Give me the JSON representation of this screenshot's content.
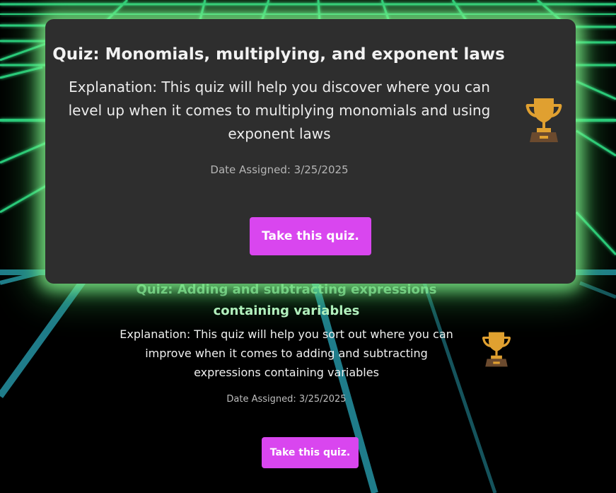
{
  "colors": {
    "background": "#000000",
    "grid_green": "#2fe08a",
    "grid_teal": "#2aa6b8",
    "card_bg": "#2e2e2e",
    "button": "#d946ef",
    "glow": "#8cff96",
    "trophy_gold": "#e0a030",
    "trophy_base": "#6b4a2e"
  },
  "quizzes": [
    {
      "title": "Quiz: Monomials, multiplying, and exponent laws",
      "explanation": "Explanation: This quiz will help you discover where you can level up when it comes to multiplying monomials and using exponent laws",
      "date": "Date Assigned: 3/25/2025",
      "button_label": "Take this quiz.",
      "icon": "trophy-icon"
    },
    {
      "title_line1": "Quiz: Adding and subtracting expressions",
      "title_line2": "containing variables",
      "explanation": "Explanation: This quiz will help you sort out where you can improve when it comes to adding and subtracting expressions containing variables",
      "date": "Date Assigned: 3/25/2025",
      "button_label": "Take this quiz.",
      "icon": "trophy-icon"
    }
  ]
}
